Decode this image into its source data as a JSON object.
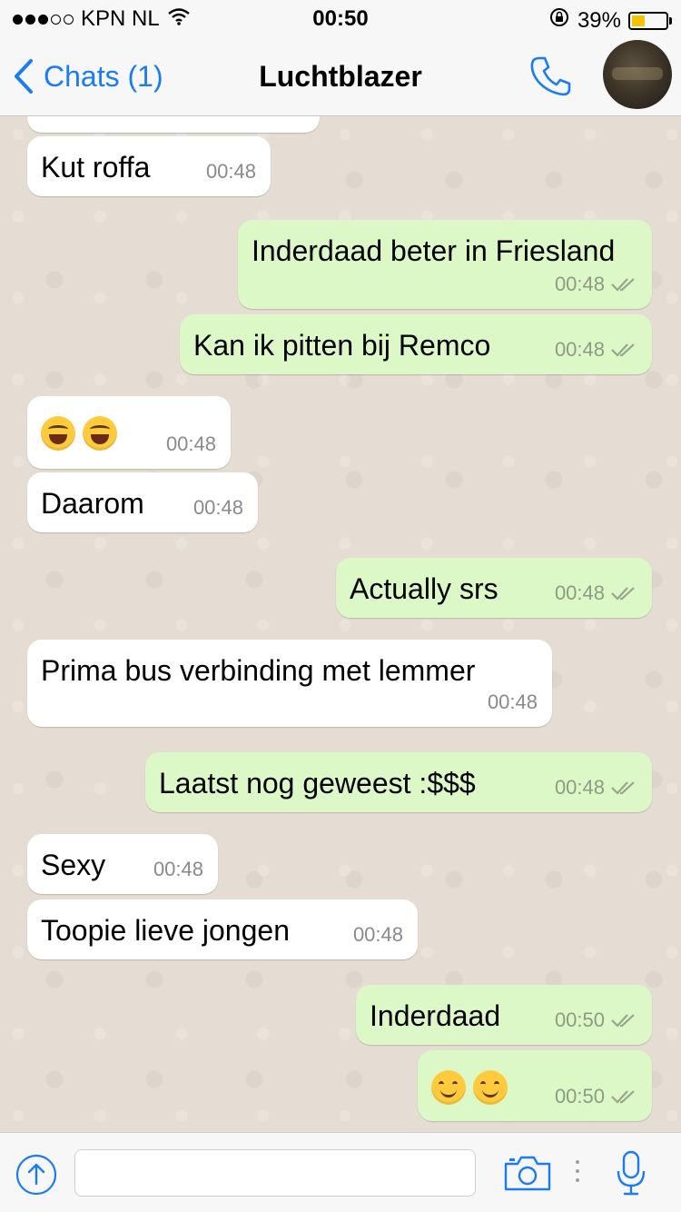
{
  "status_bar": {
    "carrier": "KPN NL",
    "time": "00:50",
    "battery_percent": "39%",
    "battery_level": 0.39,
    "signal_bars_filled": 3,
    "signal_bars_total": 5
  },
  "nav": {
    "back_label": "Chats (1)",
    "title": "Luchtblazer"
  },
  "messages": [
    {
      "direction": "in",
      "text": "Kut roffa",
      "time": "00:48"
    },
    {
      "direction": "out",
      "text": "Inderdaad beter in Friesland",
      "time": "00:48",
      "read": true
    },
    {
      "direction": "out",
      "text": "Kan ik pitten bij Remco",
      "time": "00:48",
      "read": true
    },
    {
      "direction": "in",
      "emoji": [
        "laugh",
        "laugh"
      ],
      "time": "00:48"
    },
    {
      "direction": "in",
      "text": "Daarom",
      "time": "00:48"
    },
    {
      "direction": "out",
      "text": "Actually srs",
      "time": "00:48",
      "read": true
    },
    {
      "direction": "in",
      "text": "Prima bus verbinding met lemmer",
      "time": "00:48"
    },
    {
      "direction": "out",
      "text": "Laatst nog geweest :$$$",
      "time": "00:48",
      "read": true
    },
    {
      "direction": "in",
      "text": "Sexy",
      "time": "00:48"
    },
    {
      "direction": "in",
      "text": "Toopie lieve jongen",
      "time": "00:48"
    },
    {
      "direction": "out",
      "text": "Inderdaad",
      "time": "00:50",
      "read": true
    },
    {
      "direction": "out",
      "emoji": [
        "smile",
        "smile"
      ],
      "time": "00:50",
      "read": true
    }
  ],
  "input": {
    "placeholder": "",
    "value": ""
  },
  "colors": {
    "accent": "#1a7cf5",
    "incoming_bubble": "#ffffff",
    "outgoing_bubble": "#dcf8c6",
    "chat_background": "#e5ddd3"
  },
  "icons": {
    "back": "chevron-left-icon",
    "call": "phone-icon",
    "attach": "upload-arrow-icon",
    "camera": "camera-icon",
    "mic": "microphone-icon"
  }
}
